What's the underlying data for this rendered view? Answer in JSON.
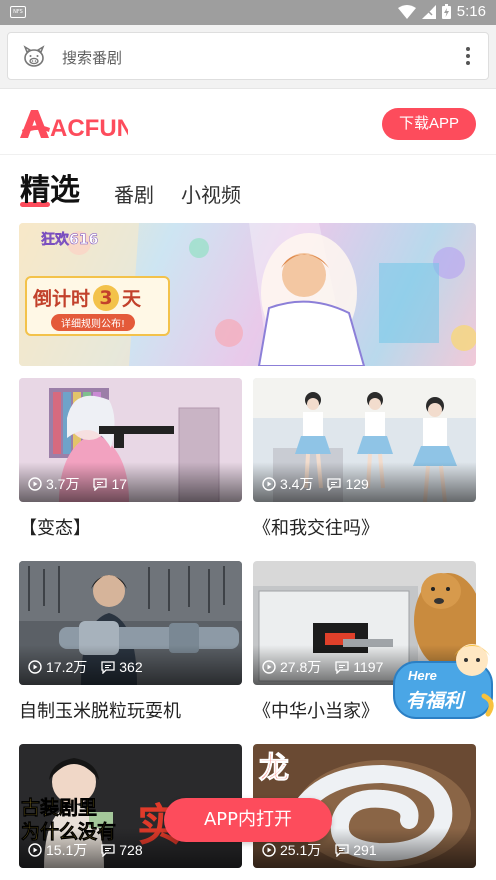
{
  "status_bar": {
    "time": "5:16",
    "notification_label": "NFS"
  },
  "browser": {
    "search_placeholder": "搜索番剧"
  },
  "header": {
    "logo_text": "ACFUN",
    "download_button": "下载APP"
  },
  "tabs": [
    {
      "label": "精选",
      "active": true
    },
    {
      "label": "番剧",
      "active": false
    },
    {
      "label": "小视频",
      "active": false
    }
  ],
  "banner": {
    "countdown_prefix": "倒计时",
    "countdown_number": "3",
    "countdown_suffix": "天",
    "rules_label": "详细规则公布!",
    "event_label": "狂欢616"
  },
  "videos": [
    {
      "title": "【变态】",
      "views": "3.7万",
      "comments": "17"
    },
    {
      "title": "《和我交往吗》",
      "views": "3.4万",
      "comments": "129"
    },
    {
      "title": "自制玉米脱粒玩耍机",
      "views": "17.2万",
      "comments": "362"
    },
    {
      "title": "《中华小当家》",
      "views": "27.8万",
      "comments": "1197"
    },
    {
      "title": "",
      "views": "15.1万",
      "comments": "728",
      "thumb_text_1": "古装剧里",
      "thumb_text_2": "为什么没有",
      "thumb_text_3": "实"
    },
    {
      "title": "",
      "views": "25.1万",
      "comments": "291",
      "thumb_text": "龙"
    }
  ],
  "float_badge": {
    "line1": "Here",
    "line2": "有福利"
  },
  "open_in_app_button": "APP内打开",
  "colors": {
    "accent": "#fd4c5c",
    "banner_gold": "#f3c24a"
  }
}
